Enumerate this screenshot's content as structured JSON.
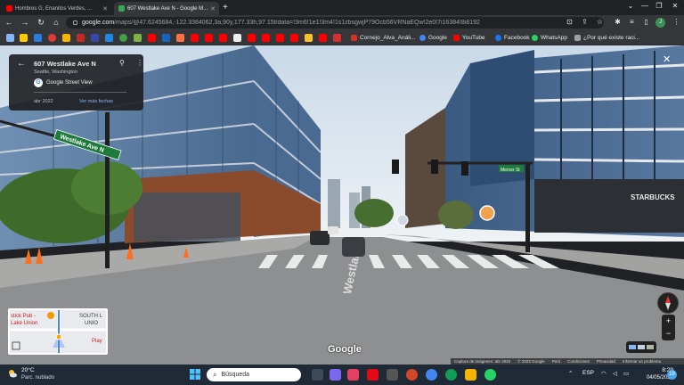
{
  "browser": {
    "tabs": [
      {
        "title": "Hombres G, Enanitos Verdes, ...",
        "active": false
      },
      {
        "title": "607 Westlake Ave N - Google M...",
        "active": true
      }
    ],
    "url_host": "google.com",
    "url_path": "/maps/@47.6245684,-122.3384062,3a,90y,177.33h,97.15t/data=!3m6!1e1!3m4!1s1zbsgwjP79Ocb56VRNaEQw!2e0!7i16384!8i8192",
    "profile_initial": "J"
  },
  "bookmarks": [
    {
      "label": "Cornejo_Alva_Análi...",
      "icon": "pdf-icon"
    },
    {
      "label": "Google",
      "icon": "google-icon"
    },
    {
      "label": "YouTube",
      "icon": "youtube-icon"
    },
    {
      "label": "Facebook",
      "icon": "facebook-icon"
    },
    {
      "label": "WhatsApp",
      "icon": "whatsapp-icon"
    },
    {
      "label": "¿Por qué existe raci...",
      "icon": "page-icon"
    }
  ],
  "streetview": {
    "address": "607 Westlake Ave N",
    "city": "Seattle, Washington",
    "provider": "Google Street View",
    "capture_date": "abr 2022",
    "more_dates": "Ver más fechas",
    "sign_westlake": "Westlake Ave N",
    "sign_mercer": "Mercer St",
    "road_text": "Westlake",
    "starbucks": "STARBUCKS",
    "google_logo": "Google",
    "attribution": [
      "Captura de imágenes: abr 2022",
      "© 2023 Google",
      "Perú",
      "Condiciones",
      "Privacidad",
      "Informar un problema"
    ],
    "minimap_labels": [
      "stick Pub -",
      "Lake Union",
      "SOUTH L",
      "UNIO",
      "Play"
    ]
  },
  "taskbar": {
    "temp": "20°C",
    "weather": "Parc. nublado",
    "search_placeholder": "Búsqueda",
    "lang": "ESP",
    "time": "8:29",
    "date": "04/05/2023",
    "notif_count": "19"
  },
  "colors": {
    "sky": "#dfe7ee",
    "glass": "#5b7fa6",
    "road": "#8d8f91",
    "chrome_bg": "#35363a",
    "taskbar": "#1f2a36"
  }
}
